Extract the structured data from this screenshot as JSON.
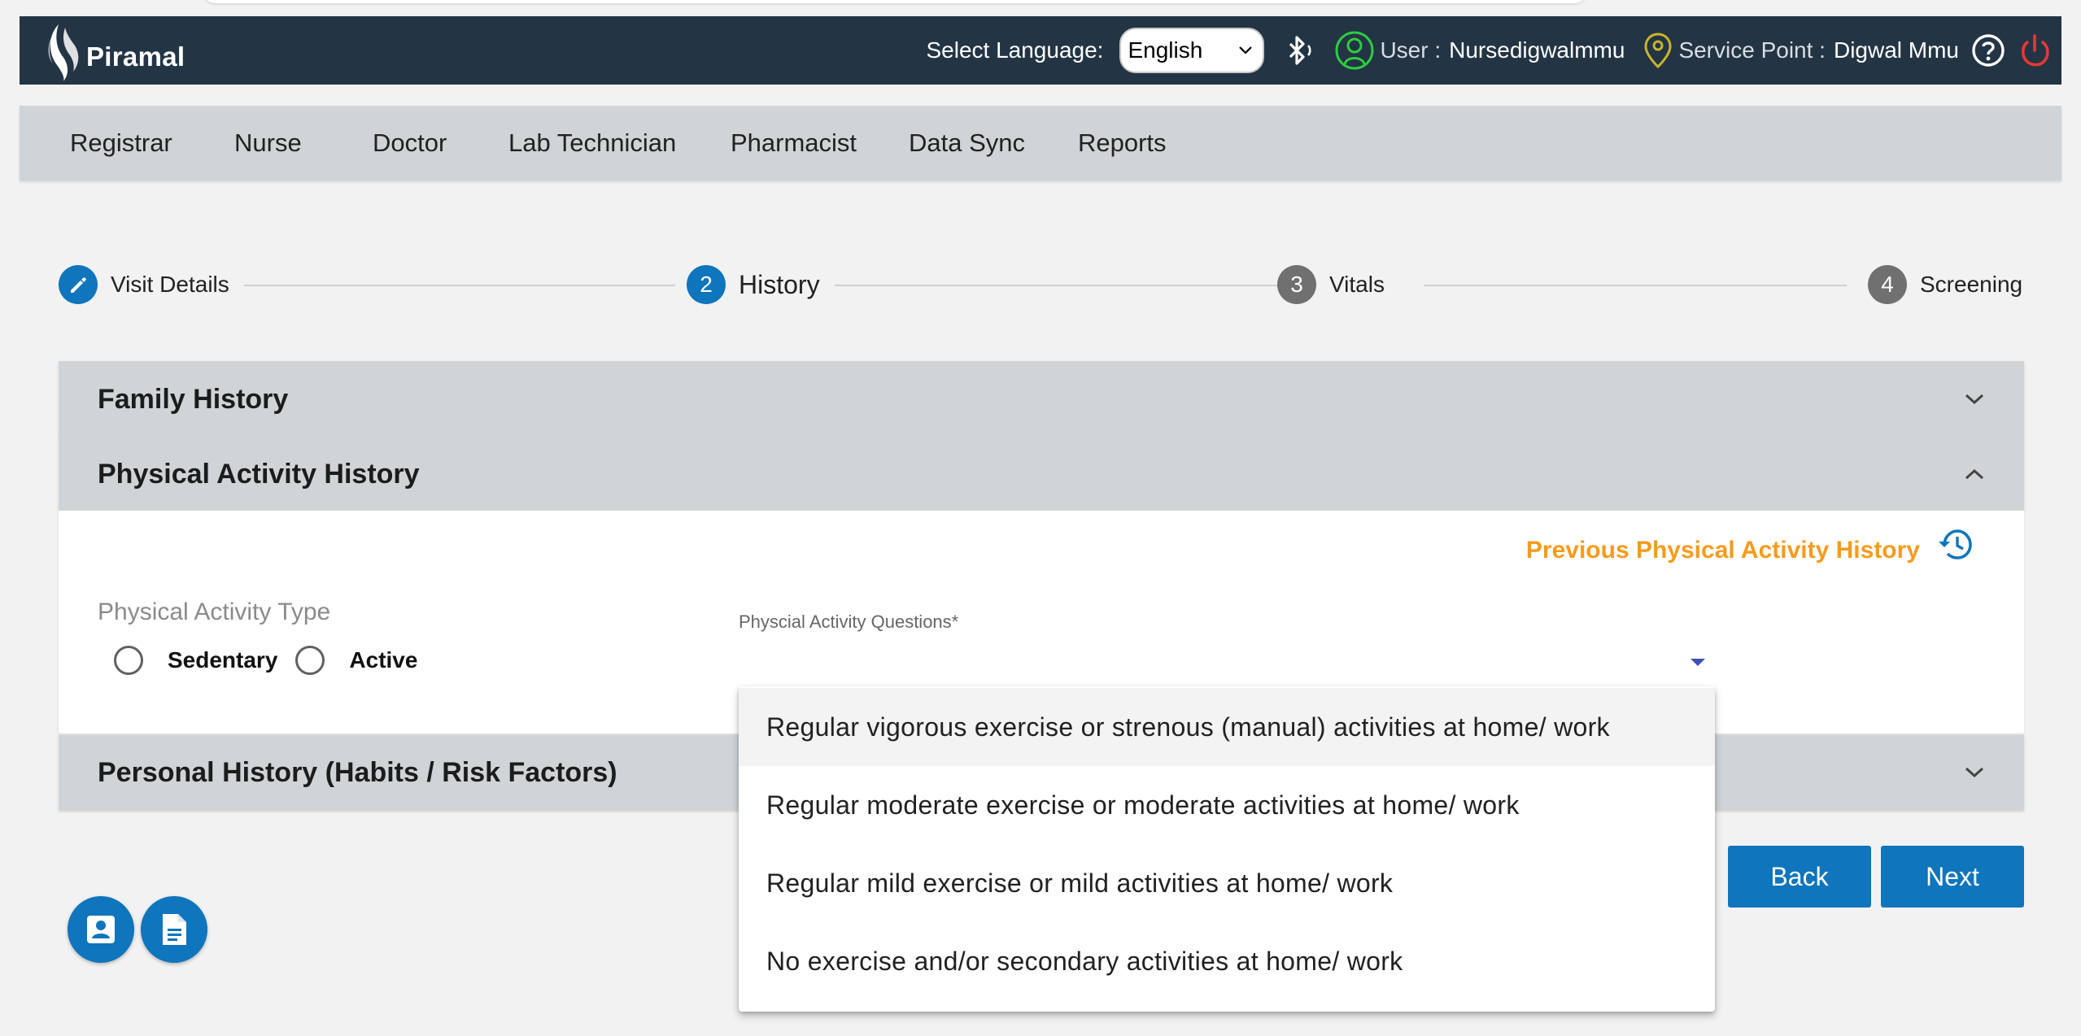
{
  "header": {
    "brand": "Piramal",
    "language_label": "Select Language:",
    "language_value": "English",
    "user_label": "User :",
    "user_name": "Nursedigwalmmu",
    "service_point_label": "Service Point :",
    "service_point_name": "Digwal Mmu"
  },
  "role_nav": {
    "items": [
      {
        "label": "Registrar"
      },
      {
        "label": "Nurse"
      },
      {
        "label": "Doctor"
      },
      {
        "label": "Lab Technician"
      },
      {
        "label": "Pharmacist"
      },
      {
        "label": "Data Sync"
      },
      {
        "label": "Reports"
      }
    ]
  },
  "stepper": {
    "steps": [
      {
        "label": "Visit Details",
        "state": "edit-icon"
      },
      {
        "number": "2",
        "label": "History",
        "state": "active"
      },
      {
        "number": "3",
        "label": "Vitals",
        "state": "pending"
      },
      {
        "number": "4",
        "label": "Screening",
        "state": "pending"
      }
    ]
  },
  "panels": {
    "family_history": {
      "title": "Family History"
    },
    "physical_activity": {
      "title": "Physical Activity History",
      "previous_link": "Previous Physical Activity History",
      "type_label": "Physical Activity Type",
      "options": [
        {
          "label": "Sedentary"
        },
        {
          "label": "Active"
        }
      ],
      "questions_label": "Physcial Activity Questions*",
      "questions_value": ""
    },
    "personal_history": {
      "title": "Personal History (Habits / Risk Factors)"
    }
  },
  "dropdown": {
    "options": [
      "Regular vigorous exercise or strenous (manual) activities at home/ work",
      "Regular moderate exercise or moderate activities at home/ work",
      "Regular mild exercise or mild activities at home/ work",
      "No exercise and/or secondary activities at home/ work"
    ],
    "highlighted_index": 0
  },
  "actions": {
    "back_label": "Back",
    "next_label": "Next"
  },
  "fabs": [
    "beneficiary-card-icon",
    "document-icon"
  ],
  "colors": {
    "header_bg": "#233445",
    "primary": "#0f75bc",
    "accent_link": "#f59b1c",
    "select_underline": "#3f51b5",
    "power": "#e53935",
    "user_icon": "#2ecc40",
    "location_icon": "#c9b52a"
  }
}
